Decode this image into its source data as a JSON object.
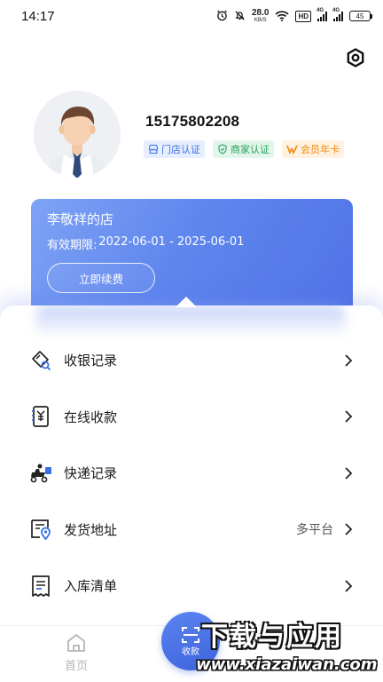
{
  "status_bar": {
    "time": "14:17",
    "net_speed_value": "28.0",
    "net_speed_unit": "KB/S",
    "hd_label": "HD",
    "signal_1_label": "4G",
    "signal_2_label": "4G",
    "battery": "45",
    "icons": [
      "alarm-icon",
      "mute-bell-icon",
      "wifi-icon",
      "signal-icon",
      "battery-icon"
    ]
  },
  "header": {
    "settings_icon": "gear-icon"
  },
  "profile": {
    "phone": "15175802208",
    "badges": [
      {
        "label": "门店认证",
        "icon": "store-icon",
        "color": "#3a6fe3"
      },
      {
        "label": "商家认证",
        "icon": "shield-icon",
        "color": "#23a35c"
      },
      {
        "label": "会员年卡",
        "icon": "vip-icon",
        "color": "#f0860f"
      }
    ]
  },
  "shop_card": {
    "name": "李敬祥的店",
    "validity_label": "有效期限:",
    "validity_range": "2022-06-01 - 2025-06-01",
    "renew_button": "立即续费"
  },
  "menu": {
    "items": [
      {
        "label": "收银记录",
        "icon": "cashier-record-icon",
        "extra": ""
      },
      {
        "label": "在线收款",
        "icon": "online-payment-icon",
        "extra": ""
      },
      {
        "label": "快递记录",
        "icon": "courier-icon",
        "extra": ""
      },
      {
        "label": "发货地址",
        "icon": "address-icon",
        "extra": "多平台"
      },
      {
        "label": "入库清单",
        "icon": "inventory-list-icon",
        "extra": ""
      }
    ]
  },
  "bottom_nav": {
    "home_label": "首页",
    "scan_label": "收款"
  },
  "watermark": {
    "title": "下载与应用",
    "url": "www.xiazaiwan.com"
  },
  "colors": {
    "accent": "#4f72e6",
    "card_gradient_start": "#7ea3f5",
    "card_gradient_end": "#4f72e6"
  }
}
